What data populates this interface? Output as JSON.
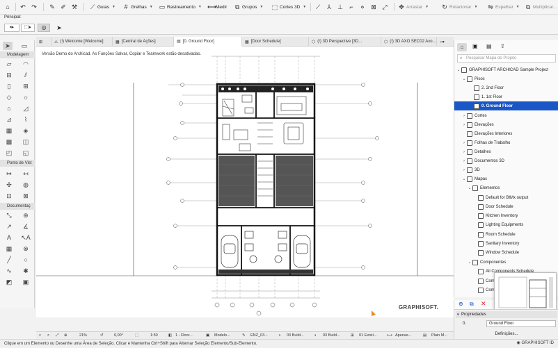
{
  "toolbar": {
    "guias": "Guias",
    "grelhas": "Grelhas",
    "rastreamento": "Rastreamento",
    "medir": "Medir",
    "grupos": "Grupos",
    "cortes3d": "Cortes 3D",
    "arrastar": "Arrastar",
    "rotacionar": "Rotacionar",
    "espelhar": "Espelhar",
    "multiplicar": "Multiplicar..."
  },
  "subbar": {
    "label": "Principal:"
  },
  "tabs": [
    {
      "label": "(!) Welcome [Welcome]"
    },
    {
      "label": "[Central de Ações]"
    },
    {
      "label": "[0. Ground Floor]"
    },
    {
      "label": "[Door Schedule]"
    },
    {
      "label": "(!) 3D Perspective [3D..."
    },
    {
      "label": "(!) 3D AXO SEC02 Axo..."
    }
  ],
  "toolbox": {
    "modelagem": "Modelagem",
    "ponto_vista": "Ponto de Vist",
    "documentacao": "Documentaç"
  },
  "canvas": {
    "notice": "Versão Demo do Archicad. As Funções Salvar, Copiar e Teamwork estão desativadas.",
    "brand": "GRAPHISOFT."
  },
  "navigator": {
    "search_placeholder": "Pesquisar Mapa do Projeto",
    "items": [
      {
        "label": "GRAPHISOFT ARCHICAD Sample Project"
      },
      {
        "label": "Pisos"
      },
      {
        "label": "2. 2nd Floor"
      },
      {
        "label": "1. 1st Floor"
      },
      {
        "label": "0. Ground Floor"
      },
      {
        "label": "Cortes"
      },
      {
        "label": "Elevações"
      },
      {
        "label": "Elevações Interiores"
      },
      {
        "label": "Folhas de Trabalho"
      },
      {
        "label": "Detalhes"
      },
      {
        "label": "Documentos 3D"
      },
      {
        "label": "3D"
      },
      {
        "label": "Mapas"
      },
      {
        "label": "Elementos"
      },
      {
        "label": "Default for BIMx output"
      },
      {
        "label": "Door Schedule"
      },
      {
        "label": "Kitchen Inventory"
      },
      {
        "label": "Lighting Equipments"
      },
      {
        "label": "Room Schedule"
      },
      {
        "label": "Sanitary Inventory"
      },
      {
        "label": "Window Schedule"
      },
      {
        "label": "Componentes"
      },
      {
        "label": "All Components Schedule"
      },
      {
        "label": "Com"
      },
      {
        "label": "Com"
      }
    ]
  },
  "props": {
    "title": "Propriedades",
    "id": "0.",
    "value": "Ground Floor",
    "definicoes": "Definições...",
    "graphisoft_id": "GRAPHISOFT ID"
  },
  "statusbar": {
    "zoom": "21%",
    "angle": "0,00°",
    "scale": "1:50",
    "layer_combo": "1 - Floor...",
    "model": "Modelo...",
    "renov": "ENZ_03...",
    "build1": "03 Build...",
    "build2": "03 Build...",
    "exist": "01 Existi...",
    "apenas": "Apenas...",
    "plain": "Plain M..."
  },
  "hint": "Clique em um Elemento ou Desenhe uma Área de Seleção. Clicar e Mantenha Ctrl+Shift para Alternar Seleção Elemento/Sub-Elemento."
}
